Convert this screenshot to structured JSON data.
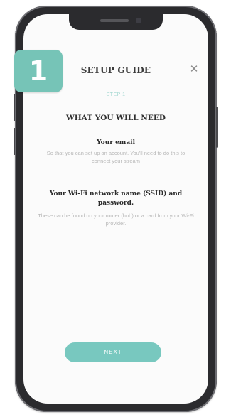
{
  "badge": {
    "number": "1"
  },
  "header": {
    "title": "SETUP GUIDE",
    "close_icon": "close-icon",
    "close_glyph": "✕"
  },
  "step": {
    "label": "STEP 1"
  },
  "section": {
    "title": "WHAT YOU WILL NEED"
  },
  "items": [
    {
      "title": "Your email",
      "description": "So that you can set up an account. You'll need to do this to connect your stream"
    },
    {
      "title": "Your Wi-Fi network name (SSID) and password.",
      "description": "These can be found on your router (hub) or a card from your Wi-Fi provider."
    }
  ],
  "footer": {
    "next_label": "NEXT"
  },
  "colors": {
    "accent": "#76c4b7",
    "button": "#78c8bf",
    "frame": "#2b2b2e"
  }
}
